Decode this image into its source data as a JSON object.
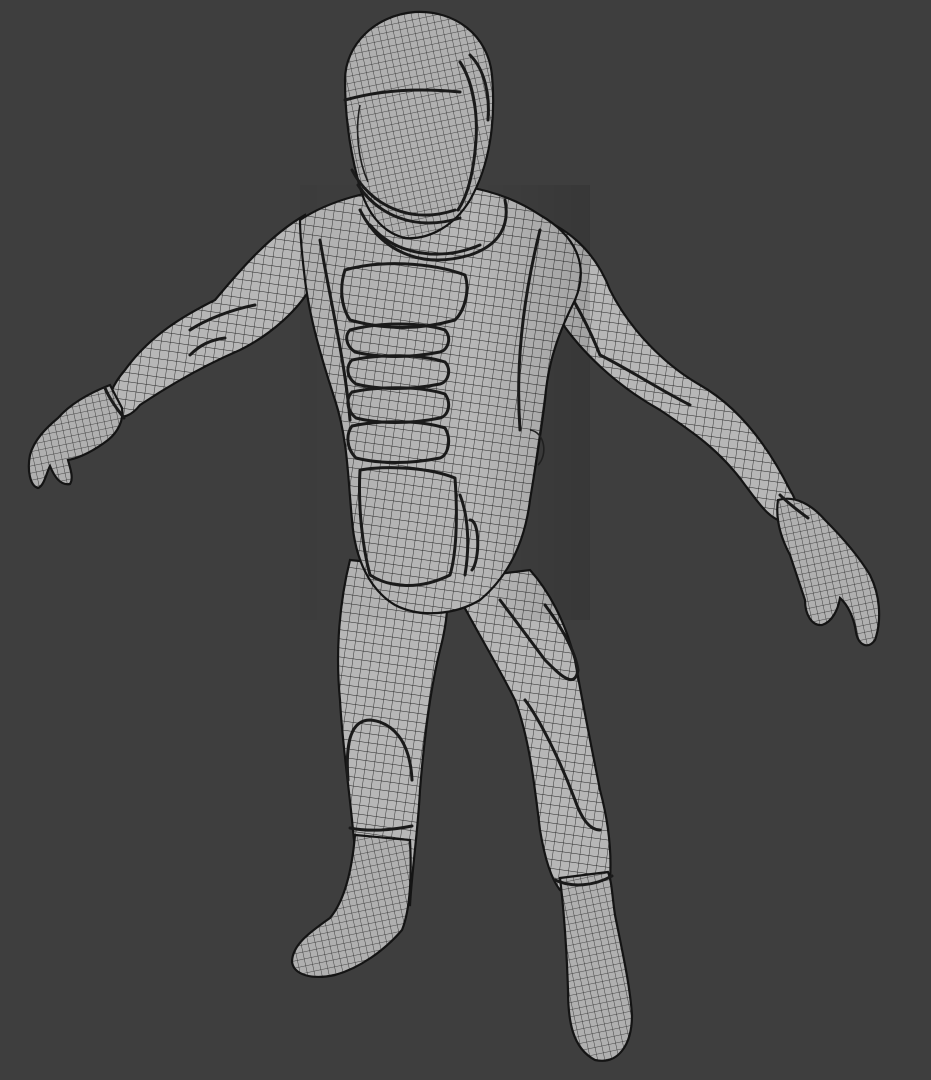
{
  "viewport": {
    "background_color": "#3e3e3e",
    "mesh_fill_color": "#b7b7b7",
    "wire_color": "#262626",
    "outline_color": "#141414",
    "shading": "wireframe-on-shaded",
    "subject": "humanoid-armored-suit-mesh"
  }
}
